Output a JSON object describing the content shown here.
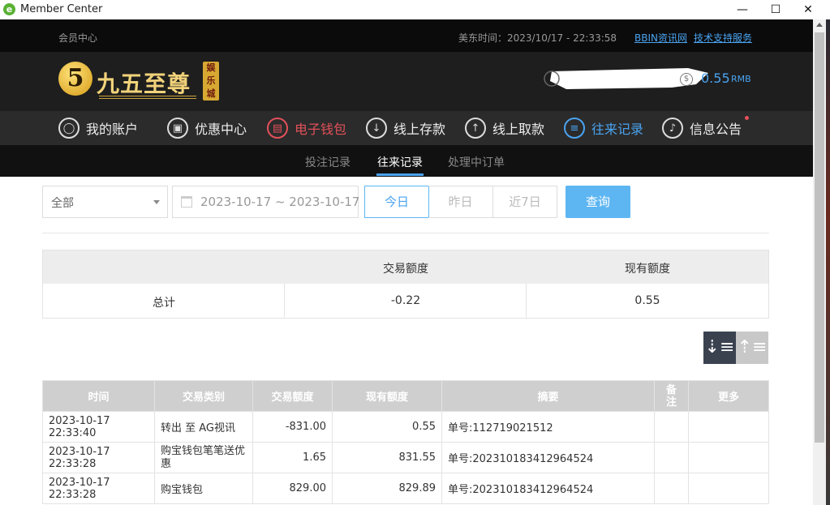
{
  "window": {
    "title": "Member Center",
    "minimize": "—",
    "maximize": "☐",
    "close": "✕"
  },
  "topbar": {
    "member_center": "会员中心",
    "time_label": "美东时间：2023/10/17 - 22:33:58",
    "link1": "BBIN资讯网",
    "link2": "技术支持服务"
  },
  "logo": {
    "five": "5",
    "name": "九五至尊",
    "tag": "娱乐城"
  },
  "balance": {
    "amount": "0.55",
    "currency": "RMB",
    "coin": "$"
  },
  "nav": [
    {
      "label": "我的账户",
      "icon": "user-icon"
    },
    {
      "label": "优惠中心",
      "icon": "gift-icon"
    },
    {
      "label": "电子钱包",
      "icon": "wallet-icon"
    },
    {
      "label": "线上存款",
      "icon": "deposit-icon"
    },
    {
      "label": "线上取款",
      "icon": "withdraw-icon"
    },
    {
      "label": "往来记录",
      "icon": "records-icon"
    },
    {
      "label": "信息公告",
      "icon": "bell-icon"
    }
  ],
  "subtabs": [
    "投注记录",
    "往来记录",
    "处理中订单"
  ],
  "filters": {
    "type_value": "全部",
    "date_range": "2023-10-17 ~ 2023-10-17",
    "today": "今日",
    "yesterday": "昨日",
    "last7": "近7日",
    "query": "查询"
  },
  "summary": {
    "col1": "交易额度",
    "col2": "现有额度",
    "row_label": "总计",
    "trade": "-0.22",
    "current": "0.55"
  },
  "table": {
    "headers": [
      "时间",
      "交易类别",
      "交易额度",
      "现有额度",
      "摘要",
      "备注",
      "更多"
    ],
    "rows": [
      {
        "time": "2023-10-17 22:33:40",
        "type": "转出 至 AG视讯",
        "amount": "-831.00",
        "balance": "0.55",
        "summary": "单号:112719021512"
      },
      {
        "time": "2023-10-17 22:33:28",
        "type": "购宝钱包笔笔送优惠",
        "amount": "1.65",
        "balance": "831.55",
        "summary": "单号:202310183412964524"
      },
      {
        "time": "2023-10-17 22:33:28",
        "type": "购宝钱包",
        "amount": "829.00",
        "balance": "829.89",
        "summary": "单号:202310183412964524"
      }
    ]
  },
  "colors": {
    "accent": "#4aa3f0",
    "highlight": "#e2505a",
    "dark": "#1e1e1e",
    "gold": "#f2d37a"
  }
}
